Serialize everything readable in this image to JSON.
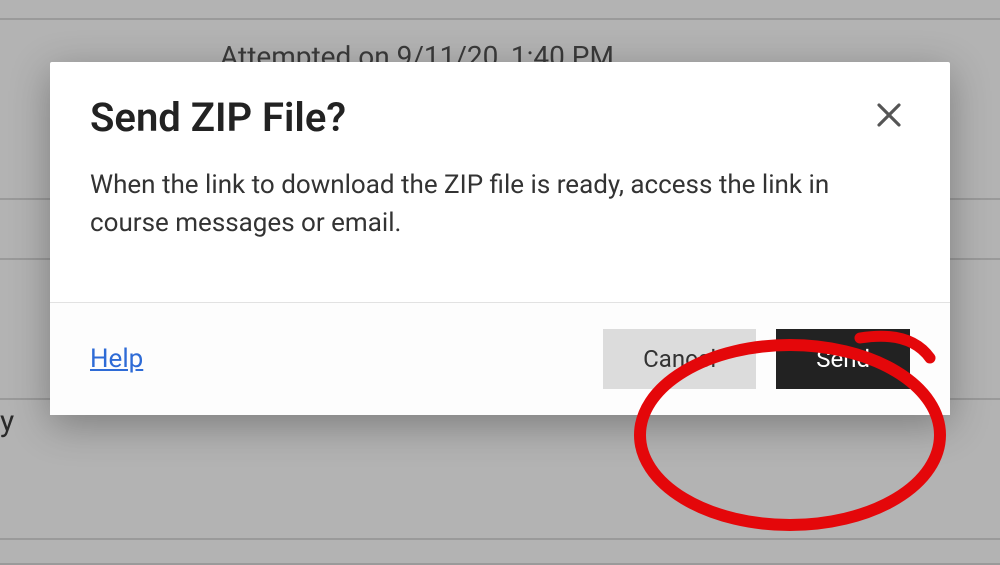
{
  "background": {
    "attempt_text": "Attempted on 9/11/20, 1:40 PM",
    "letter": "y"
  },
  "modal": {
    "title": "Send ZIP File?",
    "body_text": "When the link to download the ZIP file is ready, access the link in course messages or email.",
    "help_label": "Help",
    "cancel_label": "Cancel",
    "send_label": "Send"
  },
  "annotation": {
    "color": "#e4070a"
  }
}
